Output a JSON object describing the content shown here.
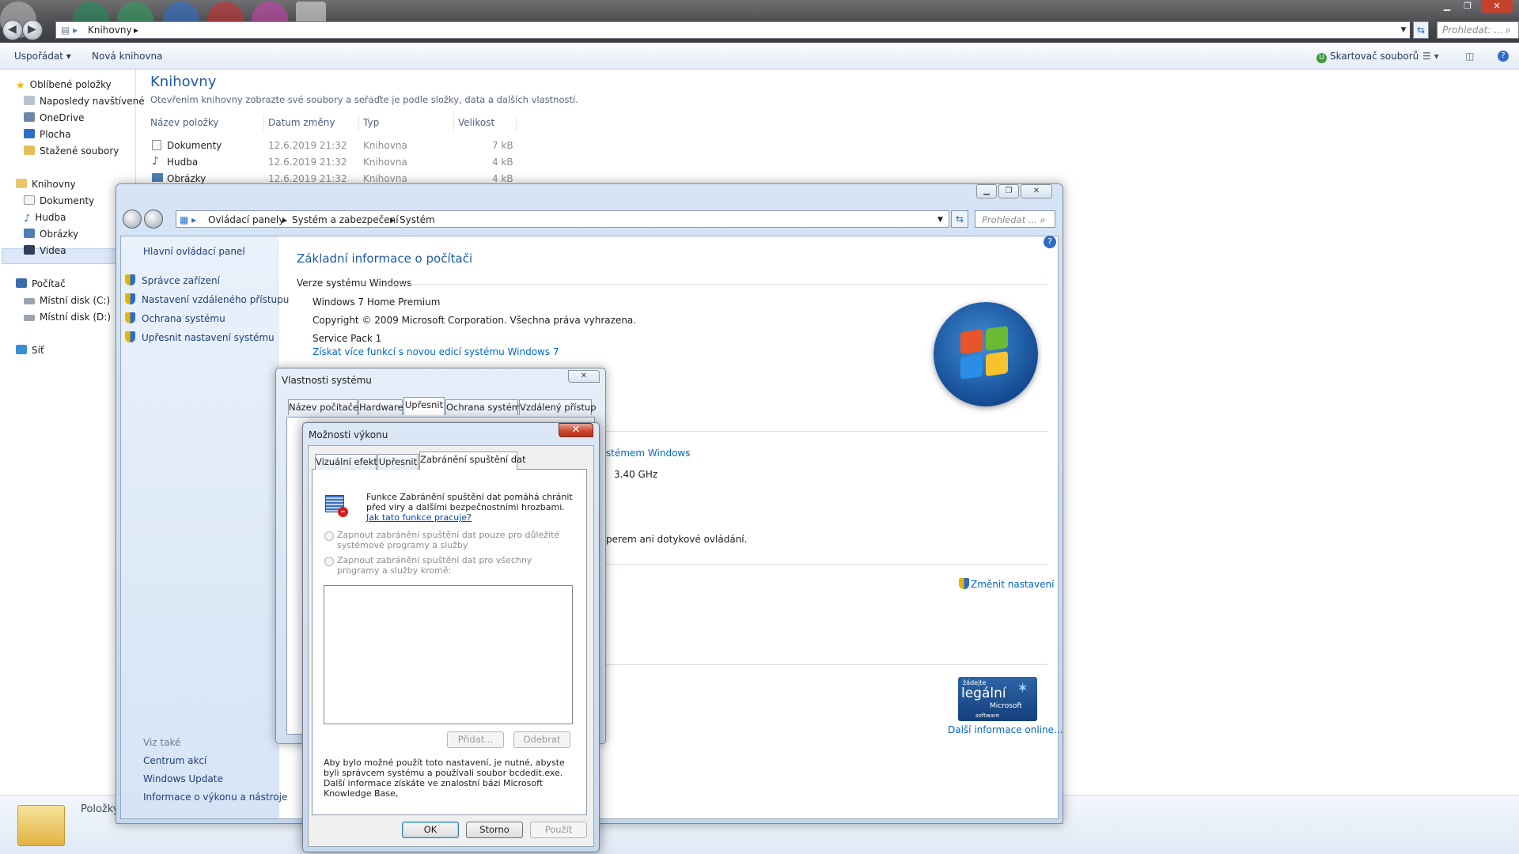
{
  "explorer": {
    "breadcrumb": "Knihovny",
    "search_placeholder": "Prohledat: ...",
    "toolbar": {
      "organize": "Uspořádat",
      "new_library": "Nová knihovna",
      "shredder": "Skartovač souborů"
    },
    "nav": {
      "favorites": "Oblíbené položky",
      "recent": "Naposledy navštívené",
      "onedrive": "OneDrive",
      "desktop": "Plocha",
      "downloads": "Stažené soubory",
      "libraries": "Knihovny",
      "lib_docs": "Dokumenty",
      "lib_music": "Hudba",
      "lib_pictures": "Obrázky",
      "lib_videos": "Videa",
      "computer": "Počítač",
      "disk_c": "Místní disk (C:)",
      "disk_d": "Místní disk (D:)",
      "network": "Síť"
    },
    "title": "Knihovny",
    "subtitle": "Otevřením knihovny zobrazte své soubory a seřaďte je podle složky, data a dalších vlastností.",
    "columns": [
      "Název položky",
      "Datum změny",
      "Typ",
      "Velikost"
    ],
    "rows": [
      {
        "name": "Dokumenty",
        "date": "12.6.2019 21:32",
        "type": "Knihovna",
        "size": "7 kB"
      },
      {
        "name": "Hudba",
        "date": "12.6.2019 21:32",
        "type": "Knihovna",
        "size": "4 kB"
      },
      {
        "name": "Obrázky",
        "date": "12.6.2019 21:32",
        "type": "Knihovna",
        "size": "4 kB"
      }
    ],
    "details_label": "Položky"
  },
  "control_panel": {
    "breadcrumb": [
      "Ovládací panely",
      "Systém a zabezpečení",
      "Systém"
    ],
    "search_placeholder": "Prohledat ...",
    "left": {
      "home": "Hlavní ovládací panel",
      "links": [
        "Správce zařízení",
        "Nastavení vzdáleného přístupu",
        "Ochrana systému",
        "Upřesnit nastavení systému"
      ],
      "see_also": "Viz také",
      "see_links": [
        "Centrum akcí",
        "Windows Update",
        "Informace o výkonu a nástroje"
      ]
    },
    "heading": "Základní informace o počítači",
    "section_edition": "Verze systému Windows",
    "edition": "Windows 7 Home Premium",
    "copyright": "Copyright © 2009 Microsoft Corporation. Všechna práva vyhrazena.",
    "service_pack": "Service Pack 1",
    "more_features": "Získat více funkcí s novou edicí systému Windows 7",
    "partial_link": "stémem Windows",
    "cpu_speed": "3.40 GHz",
    "touch": "perem ani dotykové ovládání.",
    "change_settings": "Změnit nastavení",
    "legal_badge": {
      "line1": "žádejte",
      "line2": "legální",
      "line3": "Microsoft",
      "line4": "software"
    },
    "more_online": "Další informace online..."
  },
  "system_properties": {
    "title": "Vlastnosti systému",
    "tabs": [
      "Název počítače",
      "Hardware",
      "Upřesnit",
      "Ochrana systému",
      "Vzdálený přístup"
    ]
  },
  "performance_options": {
    "title": "Možnosti výkonu",
    "tabs": [
      "Vizuální efekty",
      "Upřesnit",
      "Zabránění spuštění dat"
    ],
    "info_text": "Funkce Zabránění spuštění dat pomáhá chránit před viry a dalšími bezpečnostními hrozbami.",
    "info_link": "Jak tato funkce pracuje?",
    "option1": "Zapnout zabránění spuštění dat pouze pro důležité systémové programy a služby",
    "option2": "Zapnout zabránění spuštění dat pro všechny programy a služby kromě:",
    "add": "Přidat...",
    "remove": "Odebrat",
    "note": "Aby bylo možné použít toto nastavení, je nutné, abyste byli správcem systému a používali soubor bcdedit.exe. Další informace získáte ve znalostní bázi Microsoft Knowledge Base,",
    "ok": "OK",
    "cancel": "Storno",
    "apply": "Použít"
  }
}
